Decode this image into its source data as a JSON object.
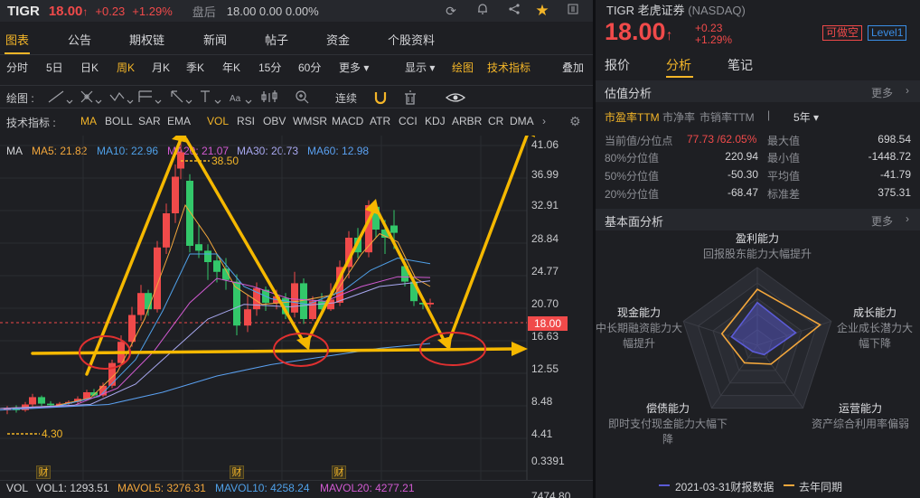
{
  "header": {
    "symbol": "TIGR",
    "price": "18.00",
    "arrow": "↑",
    "change": "+0.23",
    "change_pct": "+1.29%",
    "after_hours_label": "盘后",
    "after_hours_value": "18.00 0.00 0.00%"
  },
  "tabs": [
    "图表",
    "公告",
    "期权链",
    "新闻",
    "帖子",
    "资金",
    "个股资料"
  ],
  "periods": {
    "items": [
      "分时",
      "5日",
      "日K",
      "周K",
      "月K",
      "季K",
      "年K",
      "15分",
      "60分",
      "更多 ▾"
    ],
    "active": "周K",
    "display": "显示 ▾",
    "draw": "绘图",
    "tech": "技术指标",
    "overlay": "叠加"
  },
  "toolbar": {
    "draw_label": "绘图 :",
    "continuous_label": "连续"
  },
  "indicators": {
    "label": "技术指标 :",
    "items": [
      "MA",
      "BOLL",
      "SAR",
      "EMA",
      "VOL",
      "RSI",
      "OBV",
      "WMSR",
      "MACD",
      "ATR",
      "CCI",
      "KDJ",
      "ARBR",
      "CR",
      "DMA"
    ]
  },
  "ma_row": {
    "label": "MA",
    "ma5": "MA5: 21.82",
    "ma10": "MA10: 22.96",
    "ma20": "MA20: 21.07",
    "ma30": "MA30: 20.73",
    "ma60": "MA60: 12.98",
    "colors": {
      "ma5": "#f3a73c",
      "ma10": "#4fa0e8",
      "ma20": "#d25ad2",
      "ma30": "#a8a8f0",
      "ma60": "#5aa0f0"
    }
  },
  "y_axis": [
    "41.06",
    "36.99",
    "32.91",
    "28.84",
    "24.77",
    "20.70",
    "16.63",
    "12.55",
    "8.48",
    "4.41",
    "0.3391"
  ],
  "price_tag": "18.00",
  "annotations": {
    "high": "38.50",
    "low": "4.30"
  },
  "finance_badge": "财",
  "vol_row": {
    "label": "VOL",
    "vol1": "VOL1: 1293.51",
    "mavol5": "MAVOL5: 3276.31",
    "mavol10": "MAVOL10: 4258.24",
    "mavol20": "MAVOL20: 4277.21",
    "axis_value": "7474.80"
  },
  "colors": {
    "up": "#f04a4a",
    "down": "#33c76a",
    "accent": "#f3b528",
    "bg": "#1e1f23"
  },
  "right": {
    "title": "TIGR 老虎证券",
    "exchange": "(NASDAQ)",
    "price": "18.00",
    "arrow": "↑",
    "change": "+0.23",
    "change_pct": "+1.29%",
    "badge_short": "可做空",
    "badge_level": "Level1",
    "tabs": [
      "报价",
      "分析",
      "笔记"
    ],
    "active_tab": "分析",
    "valuation": {
      "title": "估值分析",
      "more": "更多",
      "metrics": [
        "市盈率TTM",
        "市净率",
        "市销率TTM"
      ],
      "period": "5年 ▾",
      "rows": [
        {
          "l1": "当前值/分位点",
          "v1": "77.73 /62.05%",
          "l2": "最大值",
          "v2": "698.54"
        },
        {
          "l1": "80%分位值",
          "v1": "220.94",
          "l2": "最小值",
          "v2": "-1448.72"
        },
        {
          "l1": "50%分位值",
          "v1": "-50.30",
          "l2": "平均值",
          "v2": "-41.79"
        },
        {
          "l1": "20%分位值",
          "v1": "-68.47",
          "l2": "标准差",
          "v2": "375.31"
        }
      ]
    },
    "fundamental": {
      "title": "基本面分析",
      "more": "更多",
      "axes": [
        {
          "h": "盈利能力",
          "s": "回报股东能力大幅提升"
        },
        {
          "h": "成长能力",
          "s": "企业成长潜力大幅下降"
        },
        {
          "h": "运营能力",
          "s": "资产综合利用率偏弱"
        },
        {
          "h": "偿债能力",
          "s": "即时支付现金能力大幅下降"
        },
        {
          "h": "现金能力",
          "s": "中长期融资能力大幅提升"
        }
      ],
      "current": [
        0.55,
        0.52,
        0.15,
        0.1,
        0.35
      ],
      "previous": [
        0.72,
        0.85,
        0.3,
        0.28,
        0.48
      ],
      "legend_current": "2021-03-31财报数据",
      "legend_previous": "去年同期",
      "current_color": "#5b5bd6",
      "previous_color": "#f3a73c"
    }
  }
}
